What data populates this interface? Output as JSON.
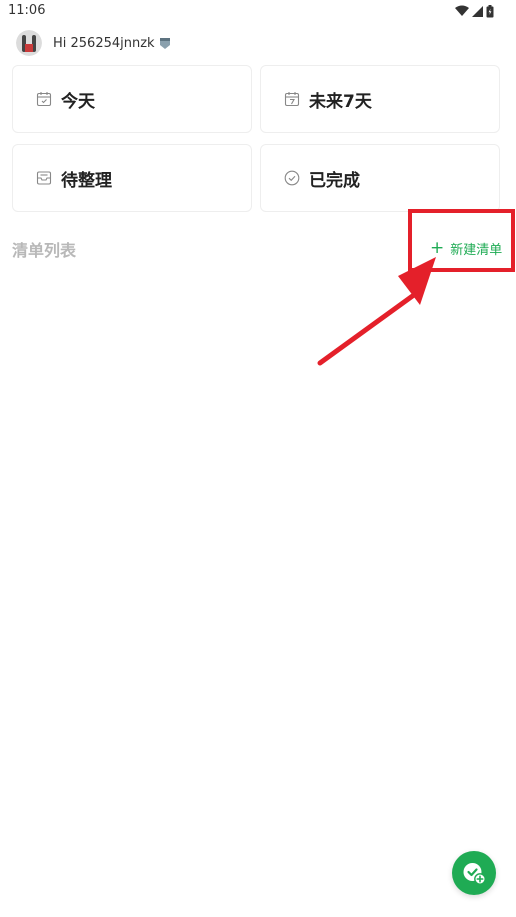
{
  "status_bar": {
    "time": "11:06"
  },
  "greeting": {
    "text": "Hi 256254jnnzk"
  },
  "cards": {
    "today": "今天",
    "next7": "未来7天",
    "inbox": "待整理",
    "done": "已完成"
  },
  "list_section": {
    "title": "清单列表",
    "new_list_plus": "+",
    "new_list_label": "新建清单"
  },
  "colors": {
    "accent": "#1fab54",
    "annotation": "#e4202a",
    "section_title": "#b8b8b8"
  },
  "icons": {
    "today": "calendar-check-icon",
    "next7": "calendar-7-icon",
    "inbox": "inbox-tray-icon",
    "done": "check-circle-icon",
    "fab": "add-task-icon"
  }
}
